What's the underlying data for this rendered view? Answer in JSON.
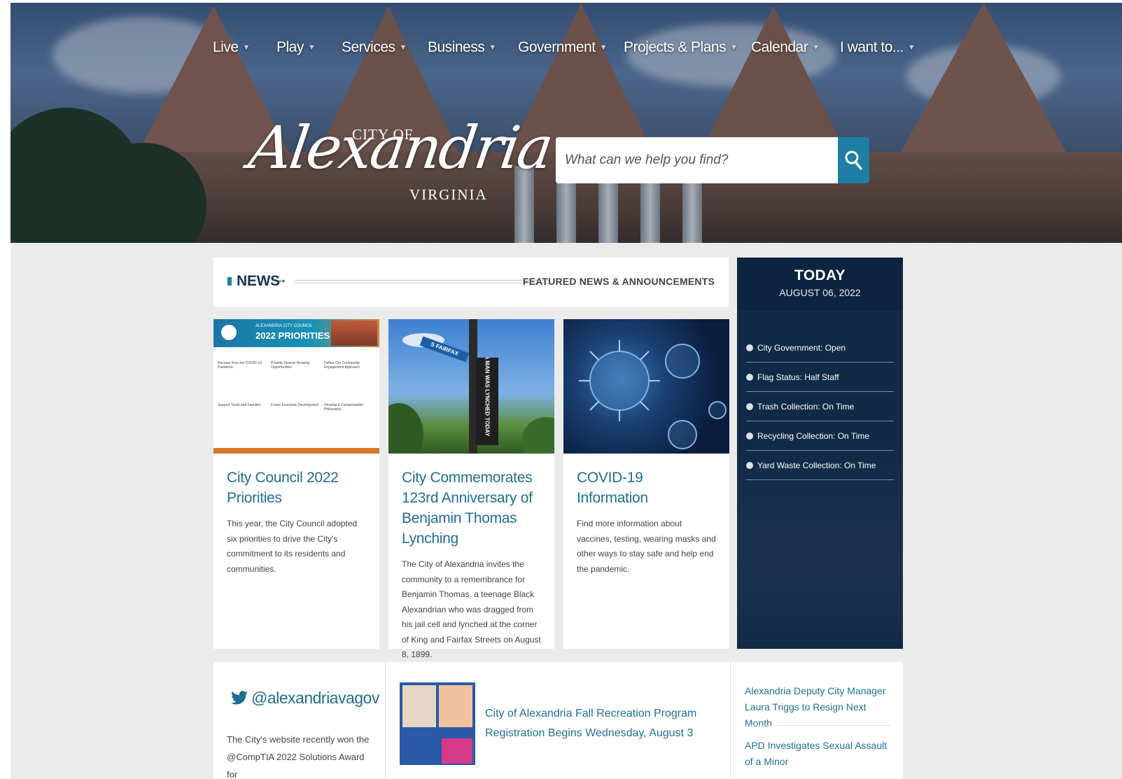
{
  "nav": {
    "items": [
      {
        "label": "Live"
      },
      {
        "label": "Play"
      },
      {
        "label": "Services"
      },
      {
        "label": "Business"
      },
      {
        "label": "Government"
      },
      {
        "label": "Projects & Plans"
      },
      {
        "label": "Calendar"
      },
      {
        "label": "I want to..."
      }
    ],
    "caret": "▼"
  },
  "logo": {
    "city_of": "CITY OF",
    "name": "Alexandria",
    "state": "VIRGINIA"
  },
  "search": {
    "placeholder": "What can we help you find?",
    "icon": "search-icon"
  },
  "news": {
    "label": "NEWS",
    "arrow": "→",
    "featured_link": "FEATURED NEWS & ANNOUNCEMENTS",
    "cards": [
      {
        "title": "City Council 2022 Priorities",
        "description": "This year, the City Council adopted six priorities to drive the City's commitment to its residents and communities.",
        "image": {
          "banner_small": "ALEXANDRIA CITY COUNCIL",
          "banner_big": "2022 PRIORITIES",
          "items": [
            "Recover from the COVID-19 Pandemic",
            "Provide Diverse Housing Opportunities",
            "Define Our Community Engagement Approach",
            "Support Youth and Families",
            "Foster Economic Development",
            "Develop a Compensation Philosophy"
          ]
        }
      },
      {
        "title": "City Commemorates 123rd Anniversary of Benjamin Thomas Lynching",
        "description": "The City of Alexandria invites the community to a remembrance for Benjamin Thomas, a teenage Black Alexandrian who was dragged from his jail cell and lynched at the corner of King and Fairfax Streets on August 8, 1899.",
        "image": {
          "street_sign": "S FAIRFAX",
          "banner_text": "A MAN WAS LYNCHED TODAY"
        }
      },
      {
        "title": "COVID-19 Information",
        "description": "Find more information about vaccines, testing, wearing masks and other ways to stay safe and help end the pandemic."
      }
    ]
  },
  "today": {
    "title": "TODAY",
    "date": "AUGUST 06, 2022",
    "statuses": [
      {
        "label": "City Government: Open"
      },
      {
        "label": "Flag Status: Half Staff"
      },
      {
        "label": "Trash Collection: On Time"
      },
      {
        "label": "Recycling Collection: On Time"
      },
      {
        "label": "Yard Waste Collection: On Time"
      }
    ]
  },
  "twitter": {
    "handle": "@alexandriavagov",
    "text": "The City's website recently won the @CompTIA 2022 Solutions Award for"
  },
  "feature": {
    "title": "City of Alexandria Fall Recreation Program Registration Begins Wednesday, August 3"
  },
  "headlines": [
    {
      "title": "Alexandria Deputy City Manager Laura Triggs to Resign Next Month"
    },
    {
      "title": "APD Investigates Sexual Assault of a Minor"
    }
  ],
  "colors": {
    "accent": "#1f7ea3",
    "link": "#1f6f94",
    "today_bg": "#102a47",
    "page_bg": "#ebebeb"
  }
}
